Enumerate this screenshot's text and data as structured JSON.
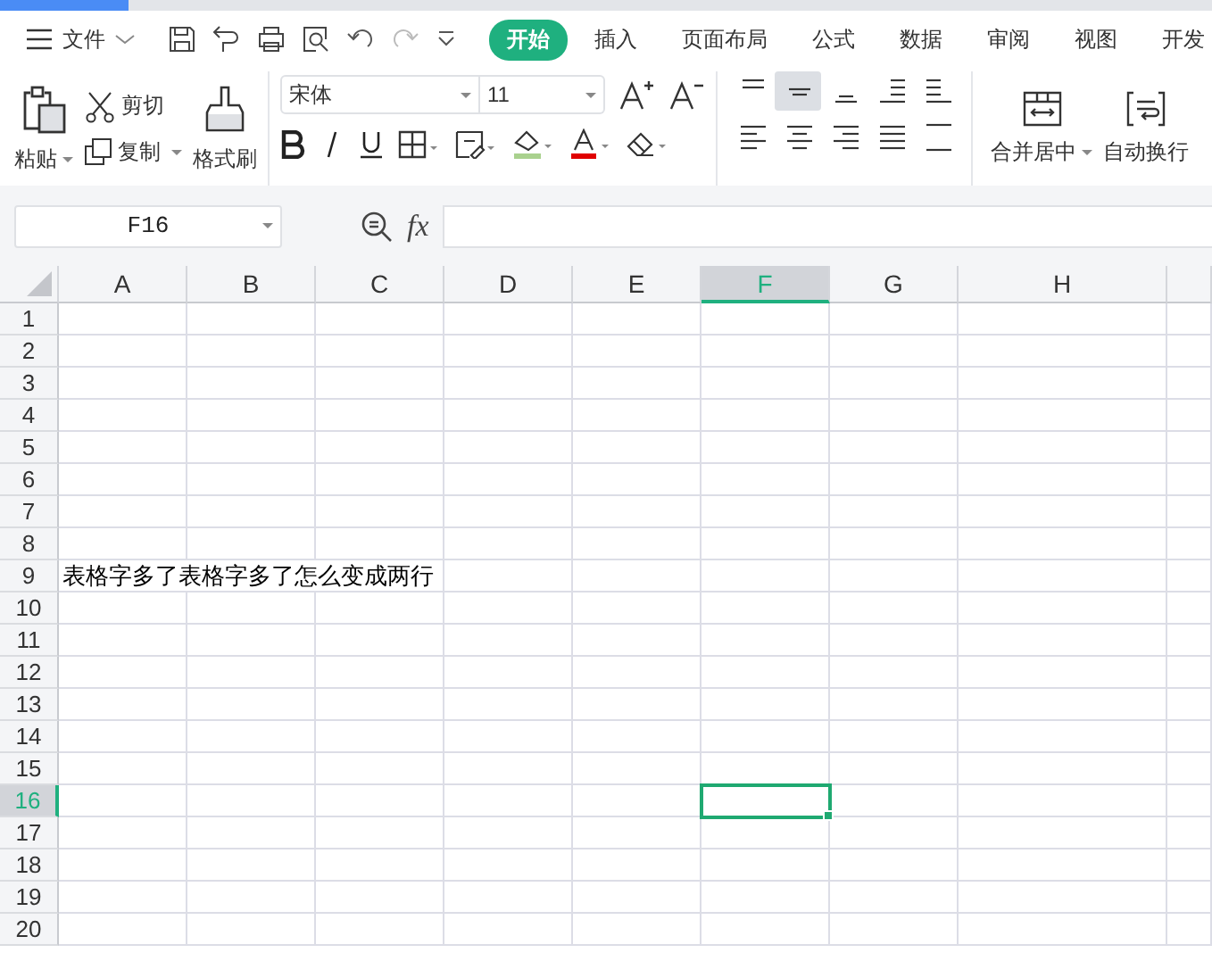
{
  "menu": {
    "label": "文件"
  },
  "tabs": [
    {
      "label": "开始",
      "selected": true
    },
    {
      "label": "插入",
      "selected": false
    },
    {
      "label": "页面布局",
      "selected": false
    },
    {
      "label": "公式",
      "selected": false
    },
    {
      "label": "数据",
      "selected": false
    },
    {
      "label": "审阅",
      "selected": false
    },
    {
      "label": "视图",
      "selected": false
    },
    {
      "label": "开发",
      "selected": false
    }
  ],
  "clipboard": {
    "paste": "粘贴",
    "cut": "剪切",
    "copy": "复制",
    "format_painter": "格式刷"
  },
  "font": {
    "name": "宋体",
    "size": "11"
  },
  "align_buttons": [
    {
      "kind": "top",
      "selected": false
    },
    {
      "kind": "middle",
      "selected": true
    },
    {
      "kind": "bottom",
      "selected": false
    },
    {
      "kind": "outdent",
      "selected": false
    },
    {
      "kind": "indent",
      "selected": false
    },
    {
      "kind": "left",
      "selected": false
    },
    {
      "kind": "center",
      "selected": false
    },
    {
      "kind": "right",
      "selected": false
    },
    {
      "kind": "justify",
      "selected": false
    },
    {
      "kind": "distribute",
      "selected": false
    }
  ],
  "merge": "合并居中",
  "wrap": "自动换行",
  "name_box": "F16",
  "fx": "fx",
  "columns": [
    {
      "label": "A",
      "selected": false
    },
    {
      "label": "B",
      "selected": false
    },
    {
      "label": "C",
      "selected": false
    },
    {
      "label": "D",
      "selected": false
    },
    {
      "label": "E",
      "selected": false
    },
    {
      "label": "F",
      "selected": true
    },
    {
      "label": "G",
      "selected": false
    },
    {
      "label": "H",
      "selected": false
    }
  ],
  "rows": [
    {
      "label": "1",
      "selected": false
    },
    {
      "label": "2",
      "selected": false
    },
    {
      "label": "3",
      "selected": false
    },
    {
      "label": "4",
      "selected": false
    },
    {
      "label": "5",
      "selected": false
    },
    {
      "label": "6",
      "selected": false
    },
    {
      "label": "7",
      "selected": false
    },
    {
      "label": "8",
      "selected": false
    },
    {
      "label": "9",
      "selected": false,
      "cells": [
        "表格字多了表格字多了怎么变成两行"
      ]
    },
    {
      "label": "10",
      "selected": false
    },
    {
      "label": "11",
      "selected": false
    },
    {
      "label": "12",
      "selected": false
    },
    {
      "label": "13",
      "selected": false
    },
    {
      "label": "14",
      "selected": false
    },
    {
      "label": "15",
      "selected": false
    },
    {
      "label": "16",
      "selected": true
    },
    {
      "label": "17",
      "selected": false
    },
    {
      "label": "18",
      "selected": false
    },
    {
      "label": "19",
      "selected": false
    },
    {
      "label": "20",
      "selected": false
    }
  ]
}
